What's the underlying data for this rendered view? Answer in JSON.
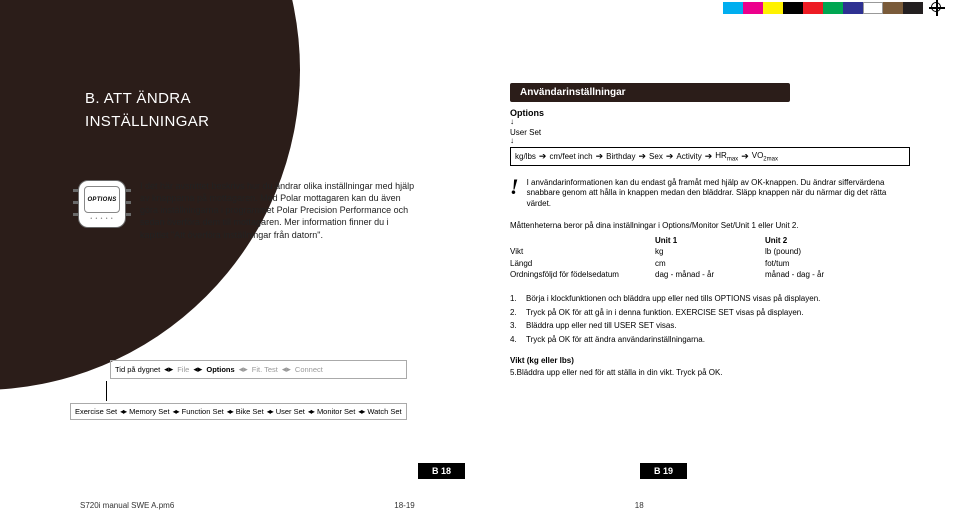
{
  "print_marks": {
    "gray_strip": [
      "#ffffff",
      "#eeeeee",
      "#dddddd",
      "#cccccc",
      "#bbbbbb",
      "#aaaaaa",
      "#999999",
      "#888888",
      "#777777",
      "#666666"
    ],
    "cmyk_bars": [
      "#00aeef",
      "#ec008c",
      "#fff200",
      "#000000",
      "#ed1c24",
      "#00a651",
      "#2e3192",
      "#ffffff",
      "#7a5b3a",
      "#231f20"
    ]
  },
  "title_lines": [
    "B. ATT ÄNDRA",
    "INSTÄLLNINGAR"
  ],
  "watch_label": "OPTIONS",
  "intro": "I det här avsnittet beskrivs hur du ändrar olika inställningar med hjälp av knapparna på mottagaren. Med Polar mottagaren kan du även göra inställningarna i programmet Polar Precision Performance och sedan överföra dem till mottagaren. Mer information finner du i kapitlet \"Att överföra inställningar från datorn\".",
  "right": {
    "header": "Användarinställningar",
    "options": "Options",
    "userset": "User Set",
    "flow": [
      "kg/lbs",
      "cm/feet inch",
      "Birthday",
      "Sex",
      "Activity",
      "HR",
      "max",
      "VO",
      "2max"
    ],
    "note": "I användarinformationen kan du endast gå framåt med hjälp av OK-knappen. Du ändrar siffervärdena snabbare genom att hålla in knappen medan den bläddrar. Släpp knappen när du närmar dig det rätta värdet.",
    "units_intro": "Måttenheterna beror på dina inställningar i Options/Monitor Set/Unit 1 eller Unit 2.",
    "units_table": {
      "headers": [
        "",
        "Unit 1",
        "Unit 2"
      ],
      "rows": [
        [
          "Vikt",
          "kg",
          "lb (pound)"
        ],
        [
          "Längd",
          "cm",
          "fot/tum"
        ],
        [
          "Ordningsföljd för födelsedatum",
          "dag - månad - år",
          "månad - dag - år"
        ]
      ]
    },
    "steps": [
      "Börja i klockfunktionen och bläddra upp eller ned tills OPTIONS visas på displayen.",
      "Tryck på OK för att gå in i denna funktion. EXERCISE SET visas på displayen.",
      "Bläddra upp eller ned till USER SET visas.",
      "Tryck på OK för att ändra användarinställningarna."
    ],
    "vikt_title": "Vikt (kg eller lbs)",
    "vikt_step": "Bläddra upp eller ned för att ställa in din vikt. Tryck på OK."
  },
  "nav": {
    "row1": [
      "Tid på dygnet",
      "File",
      "Options",
      "Fit. Test",
      "Connect"
    ],
    "row2": [
      "Exercise Set",
      "Memory Set",
      "Function Set",
      "Bike Set",
      "User Set",
      "Monitor Set",
      "Watch Set"
    ]
  },
  "pages": {
    "left": "B 18",
    "right": "B 19"
  },
  "footer": {
    "file": "S720i manual SWE A.pm6",
    "pages": "18-19",
    "sig": "18"
  }
}
